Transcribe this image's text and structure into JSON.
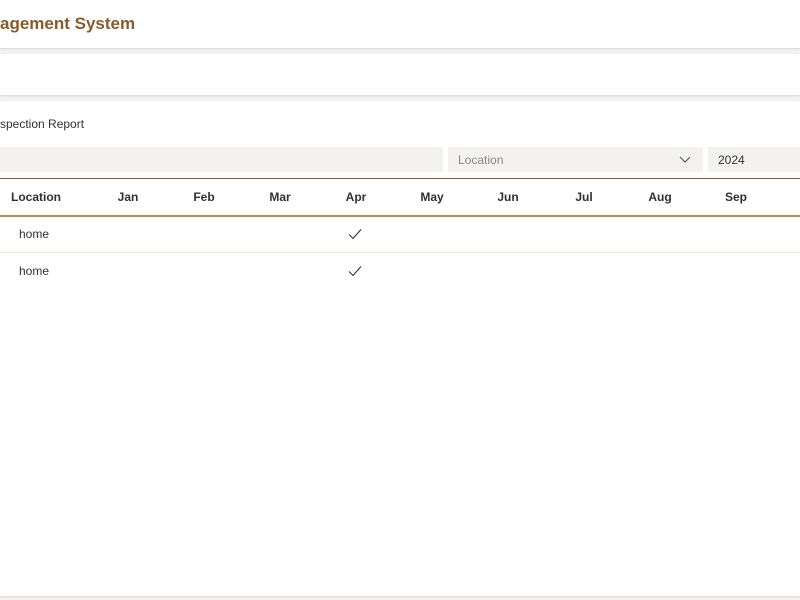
{
  "header": {
    "app_title": "agement System"
  },
  "report": {
    "title": "spection Report"
  },
  "filters": {
    "location_placeholder": "Location",
    "year_value": "2024"
  },
  "table": {
    "columns": [
      "Location",
      "Jan",
      "Feb",
      "Mar",
      "Apr",
      "May",
      "Jun",
      "Jul",
      "Aug",
      "Sep"
    ],
    "rows": [
      {
        "location": "home",
        "checked_month": "Apr"
      },
      {
        "location": "home",
        "checked_month": "Apr"
      }
    ]
  },
  "colors": {
    "accent": "#8a5a2b",
    "accent_light": "#c28a4a"
  },
  "icons": {
    "select_chevron": "chevron-down-icon",
    "checked": "check-icon"
  }
}
